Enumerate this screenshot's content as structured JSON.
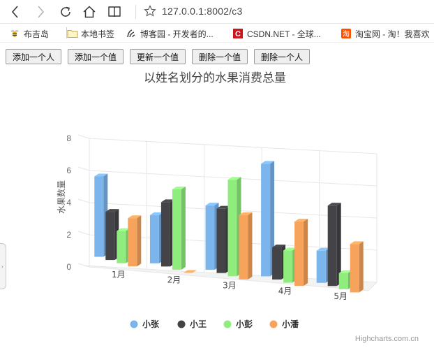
{
  "browser": {
    "url": "127.0.0.1:8002/c3",
    "icons": [
      "back-arrow-icon",
      "forward-arrow-icon",
      "refresh-icon",
      "home-icon",
      "reading-view-icon",
      "favorite-star-icon"
    ]
  },
  "bookmarks": [
    {
      "label": "布吉岛",
      "icon": "bee-icon"
    },
    {
      "label": "本地书签",
      "icon": "folder-icon"
    },
    {
      "label": "博客园 - 开发者的...",
      "icon": "cnblogs-icon"
    },
    {
      "label": "CSDN.NET - 全球...",
      "icon": "csdn-icon"
    },
    {
      "label": "淘宝网 - 淘！我喜欢",
      "icon": "taobao-icon"
    }
  ],
  "buttons": {
    "add_person": "添加一个人",
    "add_value": "添加一个值",
    "update_value": "更新一个值",
    "delete_value": "删除一个值",
    "delete_person": "删除一个人"
  },
  "colors": {
    "小张": "#7cb5ec",
    "小王": "#434348",
    "小彭": "#90ed7d",
    "小潘": "#f7a35c"
  },
  "chart_data": {
    "type": "bar",
    "style": "3d-column",
    "title": "以姓名划分的水果消费总量",
    "ylabel": "水果数量",
    "xlabel": "",
    "ylim": [
      0,
      8
    ],
    "yticks": [
      "0",
      "2",
      "4",
      "6",
      "8"
    ],
    "categories": [
      "1月",
      "2月",
      "3月",
      "4月",
      "5月"
    ],
    "series": [
      {
        "name": "小张",
        "values": [
          5,
          3,
          4,
          7,
          2
        ]
      },
      {
        "name": "小王",
        "values": [
          3,
          4,
          4,
          2,
          5
        ]
      },
      {
        "name": "小彭",
        "values": [
          2,
          5,
          6,
          2,
          1
        ]
      },
      {
        "name": "小潘",
        "values": [
          3,
          0,
          4,
          4,
          3
        ]
      }
    ],
    "grid": true,
    "legend_position": "bottom-center",
    "credits": "Highcharts.com.cn"
  }
}
